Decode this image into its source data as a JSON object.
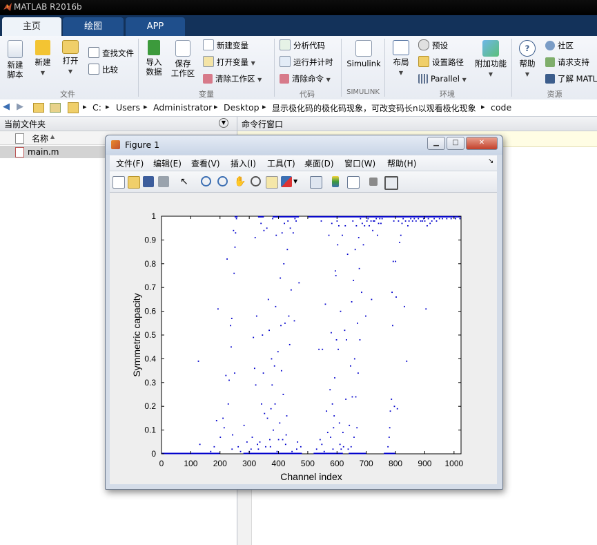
{
  "app": {
    "title": "MATLAB R2016b"
  },
  "ribbon_tabs": [
    "主页",
    "绘图",
    "APP"
  ],
  "ribbon": {
    "new_script": "新建\n脚本",
    "new": "新建",
    "open": "打开",
    "find_files": "查找文件",
    "compare": "比较",
    "group_file": "文件",
    "import_data": "导入\n数据",
    "save_workspace": "保存\n工作区",
    "new_variable": "新建变量",
    "open_variable": "打开变量",
    "clear_workspace": "清除工作区",
    "group_variable": "变量",
    "analyze_code": "分析代码",
    "run_and_time": "运行并计时",
    "clear_commands": "清除命令",
    "group_code": "代码",
    "simulink": "Simulink",
    "group_simulink": "SIMULINK",
    "layout": "布局",
    "preferences": "预设",
    "set_path": "设置路径",
    "parallel": "Parallel",
    "add_ons": "附加功能",
    "group_environment": "环境",
    "help": "帮助",
    "community": "社区",
    "request_support": "请求支持",
    "learn_matlab": "了解 MATL",
    "group_resources": "资源"
  },
  "address": {
    "crumbs": [
      "C:",
      "Users",
      "Administrator",
      "Desktop",
      "显示极化码的极化码现象，可改变码长n以观看极化现象",
      "code"
    ]
  },
  "left_panel": {
    "title": "当前文件夹",
    "column_name": "名称",
    "file": "main.m"
  },
  "command_window": {
    "title": "命令行窗口"
  },
  "figure": {
    "title": "Figure 1",
    "menus": [
      "文件(F)",
      "编辑(E)",
      "查看(V)",
      "插入(I)",
      "工具(T)",
      "桌面(D)",
      "窗口(W)",
      "帮助(H)"
    ]
  },
  "chart_data": {
    "type": "scatter",
    "xlabel": "Channel index",
    "ylabel": "Symmetric capacity",
    "xlim": [
      0,
      1024
    ],
    "ylim": [
      0,
      1
    ],
    "xticks": [
      0,
      100,
      200,
      300,
      400,
      500,
      600,
      700,
      800,
      900,
      1000
    ],
    "yticks": [
      0,
      0.1,
      0.2,
      0.3,
      0.4,
      0.5,
      0.6,
      0.7,
      0.8,
      0.9,
      1
    ],
    "marker_color": "#0000cc",
    "points": [
      [
        126,
        0.39
      ],
      [
        131,
        0.04
      ],
      [
        168,
        0.01
      ],
      [
        180,
        0.03
      ],
      [
        188,
        0.14
      ],
      [
        193,
        0.61
      ],
      [
        201,
        0.07
      ],
      [
        210,
        0.15
      ],
      [
        214,
        0.11
      ],
      [
        220,
        0.33
      ],
      [
        224,
        0.82
      ],
      [
        228,
        0.21
      ],
      [
        231,
        0.31
      ],
      [
        236,
        0.54
      ],
      [
        238,
        0.45
      ],
      [
        240,
        0.57
      ],
      [
        241,
        0.02
      ],
      [
        243,
        0.08
      ],
      [
        246,
        0.94
      ],
      [
        248,
        0.76
      ],
      [
        250,
        0.34
      ],
      [
        251,
        0.87
      ],
      [
        253,
        0.93
      ],
      [
        256,
        0.99
      ],
      [
        262,
        0.03
      ],
      [
        270,
        0.01
      ],
      [
        282,
        0.12
      ],
      [
        292,
        0.05
      ],
      [
        300,
        0.01
      ],
      [
        306,
        0.02
      ],
      [
        310,
        0.07
      ],
      [
        314,
        0.49
      ],
      [
        318,
        0.36
      ],
      [
        320,
        0.91
      ],
      [
        322,
        0.29
      ],
      [
        325,
        0.58
      ],
      [
        328,
        0.04
      ],
      [
        331,
        0.02
      ],
      [
        336,
        0.05
      ],
      [
        340,
        0.97
      ],
      [
        342,
        0.21
      ],
      [
        345,
        0.5
      ],
      [
        348,
        0.34
      ],
      [
        350,
        0.94
      ],
      [
        352,
        0.17
      ],
      [
        356,
        0.03
      ],
      [
        360,
        0.95
      ],
      [
        362,
        0.15
      ],
      [
        365,
        0.65
      ],
      [
        368,
        0.52
      ],
      [
        370,
        0.06
      ],
      [
        372,
        0.03
      ],
      [
        374,
        0.19
      ],
      [
        376,
        0.4
      ],
      [
        378,
        0.29
      ],
      [
        380,
        0.99
      ],
      [
        382,
        0.1
      ],
      [
        386,
        0.37
      ],
      [
        388,
        0.21
      ],
      [
        390,
        0.62
      ],
      [
        392,
        0.92
      ],
      [
        395,
        0.01
      ],
      [
        398,
        0.43
      ],
      [
        400,
        0.06
      ],
      [
        404,
        0.13
      ],
      [
        406,
        0.74
      ],
      [
        408,
        0.54
      ],
      [
        410,
        0.35
      ],
      [
        412,
        0.93
      ],
      [
        414,
        0.06
      ],
      [
        416,
        0.25
      ],
      [
        418,
        0.8
      ],
      [
        420,
        0.97
      ],
      [
        422,
        0.55
      ],
      [
        424,
        0.04
      ],
      [
        426,
        0.08
      ],
      [
        428,
        0.16
      ],
      [
        430,
        0.86
      ],
      [
        432,
        0.98
      ],
      [
        435,
        0.58
      ],
      [
        438,
        0.46
      ],
      [
        440,
        0.95
      ],
      [
        443,
        0.69
      ],
      [
        446,
        0.01
      ],
      [
        450,
        0.93
      ],
      [
        454,
        0.56
      ],
      [
        456,
        0.99
      ],
      [
        460,
        0.98
      ],
      [
        462,
        0.02
      ],
      [
        465,
        0.05
      ],
      [
        470,
        0.72
      ],
      [
        476,
        0.03
      ],
      [
        530,
        0.02
      ],
      [
        538,
        0.44
      ],
      [
        542,
        0.06
      ],
      [
        546,
        0.98
      ],
      [
        548,
        0.04
      ],
      [
        550,
        0.44
      ],
      [
        556,
        0.01
      ],
      [
        560,
        0.63
      ],
      [
        564,
        0.18
      ],
      [
        568,
        0.09
      ],
      [
        572,
        0.92
      ],
      [
        576,
        0.27
      ],
      [
        578,
        0.07
      ],
      [
        580,
        0.51
      ],
      [
        582,
        0.97
      ],
      [
        584,
        0.21
      ],
      [
        586,
        0.02
      ],
      [
        588,
        0.11
      ],
      [
        590,
        0.16
      ],
      [
        592,
        0.32
      ],
      [
        594,
        0.77
      ],
      [
        596,
        0.75
      ],
      [
        598,
        0.48
      ],
      [
        600,
        0.98
      ],
      [
        602,
        0.88
      ],
      [
        604,
        0.44
      ],
      [
        606,
        0.96
      ],
      [
        608,
        0.13
      ],
      [
        610,
        0.04
      ],
      [
        612,
        0.6
      ],
      [
        614,
        0.02
      ],
      [
        618,
        0.92
      ],
      [
        620,
        0.09
      ],
      [
        622,
        0.03
      ],
      [
        626,
        0.52
      ],
      [
        628,
        0.96
      ],
      [
        630,
        0.23
      ],
      [
        632,
        0.48
      ],
      [
        636,
        0.84
      ],
      [
        638,
        0.02
      ],
      [
        642,
        0.12
      ],
      [
        646,
        0.37
      ],
      [
        648,
        0.03
      ],
      [
        650,
        0.64
      ],
      [
        652,
        0.24
      ],
      [
        654,
        0.98
      ],
      [
        656,
        0.73
      ],
      [
        658,
        0.07
      ],
      [
        660,
        0.4
      ],
      [
        662,
        0.86
      ],
      [
        664,
        0.24
      ],
      [
        666,
        0.96
      ],
      [
        668,
        0.11
      ],
      [
        670,
        0.55
      ],
      [
        672,
        0.34
      ],
      [
        674,
        0.91
      ],
      [
        676,
        0.78
      ],
      [
        678,
        0.48
      ],
      [
        680,
        0.99
      ],
      [
        684,
        0.68
      ],
      [
        686,
        0.97
      ],
      [
        690,
        0.88
      ],
      [
        694,
        0.96
      ],
      [
        698,
        0.58
      ],
      [
        702,
        0.98
      ],
      [
        706,
        0.99
      ],
      [
        710,
        0.96
      ],
      [
        716,
        0.98
      ],
      [
        718,
        0.65
      ],
      [
        722,
        0.94
      ],
      [
        724,
        0.98
      ],
      [
        728,
        0.98
      ],
      [
        734,
        0.99
      ],
      [
        738,
        0.92
      ],
      [
        742,
        0.97
      ],
      [
        746,
        0.99
      ],
      [
        750,
        0.97
      ],
      [
        754,
        0.99
      ],
      [
        774,
        0.03
      ],
      [
        778,
        0.07
      ],
      [
        780,
        0.11
      ],
      [
        782,
        0.18
      ],
      [
        786,
        0.23
      ],
      [
        788,
        0.68
      ],
      [
        790,
        0.54
      ],
      [
        792,
        0.81
      ],
      [
        794,
        0.98
      ],
      [
        796,
        0.2
      ],
      [
        800,
        0.81
      ],
      [
        802,
        0.66
      ],
      [
        806,
        0.19
      ],
      [
        810,
        0.98
      ],
      [
        814,
        0.89
      ],
      [
        818,
        0.92
      ],
      [
        822,
        0.97
      ],
      [
        826,
        0.99
      ],
      [
        830,
        0.62
      ],
      [
        834,
        0.98
      ],
      [
        838,
        0.39
      ],
      [
        842,
        0.96
      ],
      [
        846,
        0.98
      ],
      [
        852,
        0.99
      ],
      [
        858,
        0.98
      ],
      [
        864,
        0.99
      ],
      [
        870,
        0.98
      ],
      [
        878,
        0.99
      ],
      [
        886,
        0.98
      ],
      [
        892,
        0.98
      ],
      [
        896,
        0.99
      ],
      [
        900,
        0.98
      ],
      [
        904,
        0.61
      ],
      [
        908,
        0.96
      ],
      [
        912,
        0.99
      ],
      [
        918,
        0.97
      ],
      [
        924,
        0.98
      ],
      [
        932,
        0.99
      ],
      [
        940,
        0.98
      ],
      [
        950,
        0.99
      ],
      [
        960,
        0.99
      ],
      [
        975,
        0.99
      ],
      [
        990,
        0.99
      ],
      [
        1005,
        0.99
      ],
      [
        1020,
        0.99
      ]
    ],
    "low_band": [
      [
        0,
        200
      ],
      [
        280,
        480
      ],
      [
        520,
        620
      ],
      [
        640,
        700
      ],
      [
        760,
        800
      ]
    ],
    "high_band": [
      [
        250,
        260
      ],
      [
        330,
        350
      ],
      [
        380,
        470
      ],
      [
        500,
        1024
      ]
    ]
  }
}
